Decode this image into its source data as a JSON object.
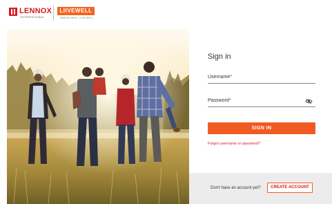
{
  "brand": {
    "lennox_name": "LENNOX",
    "lennox_sub": "INTERNATIONAL",
    "livewell_name": "LIIVEWELL",
    "livewell_tagline": "WHERE WELL LIVE WELL",
    "colors": {
      "lennox_red": "#d71920",
      "accent_orange": "#f15a22"
    }
  },
  "signin": {
    "title": "Sign in",
    "username": {
      "label": "Username",
      "required_mark": "*",
      "value": ""
    },
    "password": {
      "label": "Password",
      "required_mark": "*",
      "value": "",
      "toggle_icon": "eye-slash-icon"
    },
    "submit_label": "SIGN IN",
    "forgot_label": "Forgot username or password?"
  },
  "footer": {
    "prompt": "Don't have an account yet?",
    "create_label": "CREATE ACCOUNT"
  },
  "hero": {
    "image": "family-walking-in-autumn-field-photo"
  }
}
